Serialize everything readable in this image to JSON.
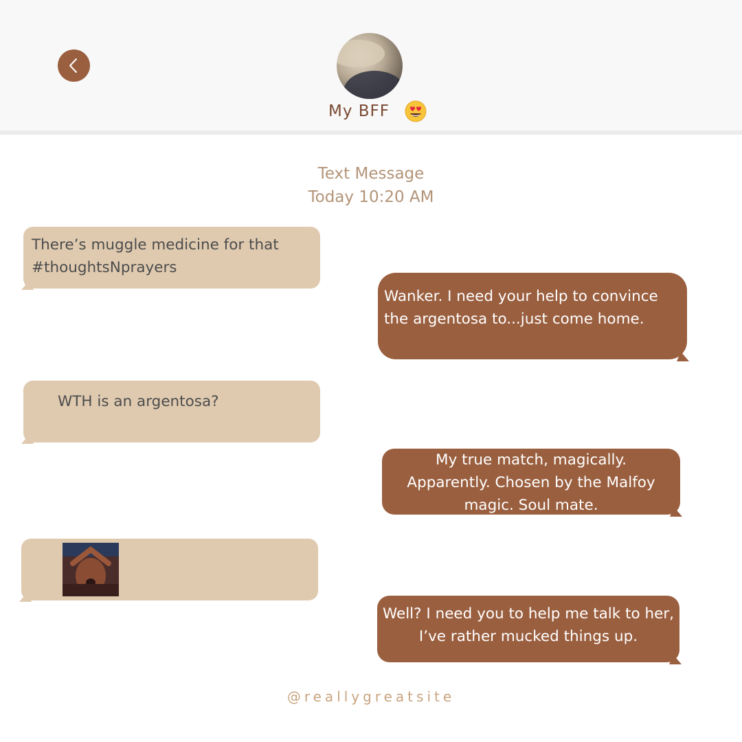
{
  "header": {
    "contact_name": "My BFF",
    "contact_emoji": "heart-eyes-emoji",
    "back_icon": "chevron-left-icon"
  },
  "thread": {
    "title": "Text Message",
    "timestamp": "Today 10:20 AM"
  },
  "messages": [
    {
      "direction": "incoming",
      "text": "There’s muggle medicine for that #thoughtsNprayers"
    },
    {
      "direction": "outgoing",
      "text": "Wanker. I need your help to convince the argentosa to...just come home."
    },
    {
      "direction": "incoming",
      "text": "WTH is an argentosa?"
    },
    {
      "direction": "outgoing",
      "text": "My true match, magically. Apparently. Chosen by the Malfoy magic. Soul mate."
    },
    {
      "direction": "incoming",
      "image": "reaction-gif"
    },
    {
      "direction": "outgoing",
      "text": "Well? I need you to help me talk to her, I’ve rather mucked things up."
    }
  ],
  "footer": {
    "handle": "@reallygreatsite"
  },
  "colors": {
    "accent": "#9a5f3f",
    "incoming_bubble": "#dfcab0",
    "header_bg": "#f8f8f8",
    "meta_text": "#b39478"
  }
}
